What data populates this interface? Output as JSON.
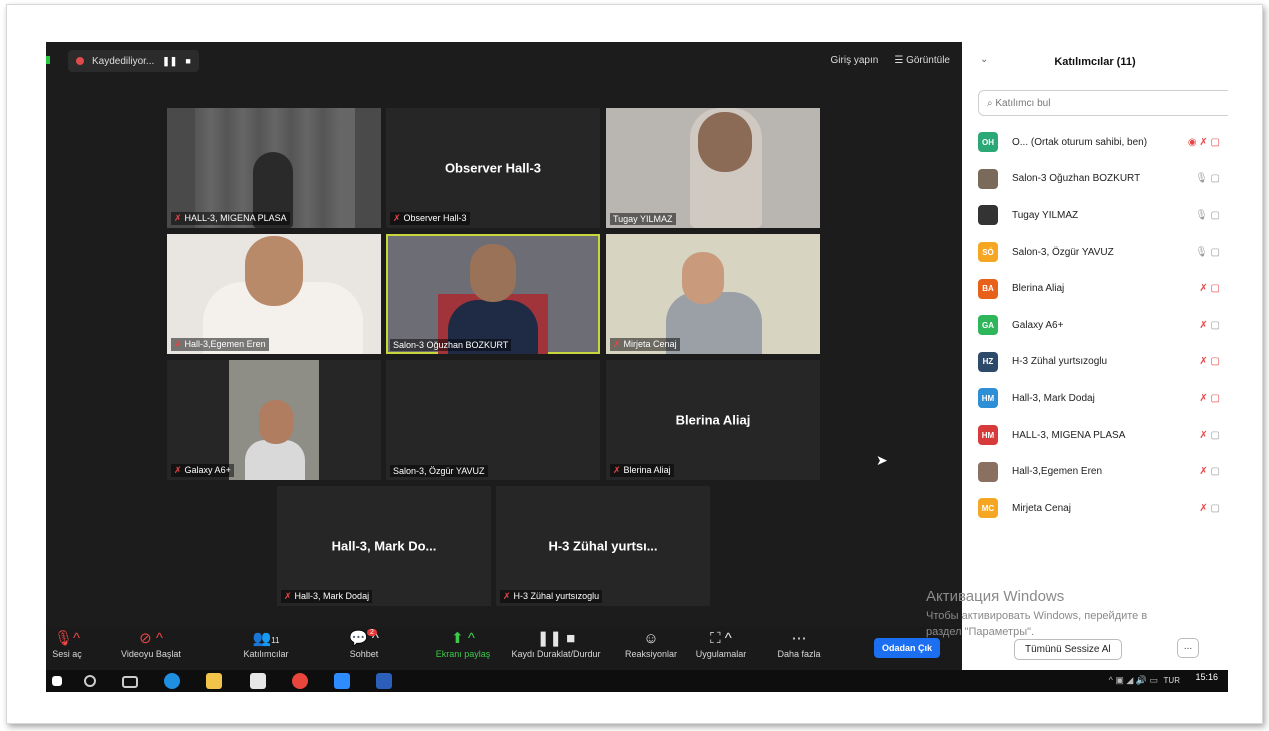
{
  "recording": {
    "label": "Kaydediliyor...",
    "pause_icon": "pause-icon",
    "stop_icon": "stop-icon"
  },
  "topbar": {
    "signin": "Giriş yapın",
    "view": "Görüntüle"
  },
  "tiles": [
    {
      "label": "HALL-3, MIGENA PLASA",
      "muted": true
    },
    {
      "label": "Observer Hall-3",
      "muted": true,
      "center": "Observer Hall-3"
    },
    {
      "label": "Tugay YILMAZ",
      "muted": false
    },
    {
      "label": "Hall-3,Egemen Eren",
      "muted": true
    },
    {
      "label": "Salon-3 Oğuzhan BOZKURT",
      "muted": false
    },
    {
      "label": "Mirjeta Cenaj",
      "muted": true
    },
    {
      "label": "Galaxy A6+",
      "muted": true
    },
    {
      "label": "Salon-3, Özgür YAVUZ",
      "muted": false
    },
    {
      "label": "Blerina Aliaj",
      "muted": true,
      "center": "Blerina Aliaj"
    },
    {
      "label": "Hall-3, Mark Dodaj",
      "muted": true,
      "center": "Hall-3, Mark Do..."
    },
    {
      "label": "H-3 Zühal yurtsızoglu",
      "muted": true,
      "center": "H-3 Zühal yurtsı..."
    }
  ],
  "toolbar": {
    "audio": "Sesi aç",
    "video": "Videoyu Başlat",
    "participants": "Katılımcılar",
    "participants_count": "11",
    "chat": "Sohbet",
    "chat_badge": "2",
    "share": "Ekranı paylaş",
    "record": "Kaydı Duraklat/Durdur",
    "reactions": "Reaksiyonlar",
    "apps": "Uygulamalar",
    "more": "Daha fazla",
    "leave": "Odadan Çık"
  },
  "panel": {
    "title": "Katılımcılar (11)",
    "search_placeholder": "Katılımcı bul",
    "participants": [
      {
        "initials": "OH",
        "name": "O... (Ortak oturum sahibi, ben)",
        "color": "#2aa876"
      },
      {
        "initials": "",
        "name": "Salon-3 Oğuzhan BOZKURT",
        "color": "#7a6a5a"
      },
      {
        "initials": "",
        "name": "Tugay YILMAZ",
        "color": "#333333"
      },
      {
        "initials": "SÖ",
        "name": "Salon-3, Özgür YAVUZ",
        "color": "#f5a623"
      },
      {
        "initials": "BA",
        "name": "Blerina Aliaj",
        "color": "#e8611a"
      },
      {
        "initials": "GA",
        "name": "Galaxy A6+",
        "color": "#2fb55a"
      },
      {
        "initials": "HZ",
        "name": "H-3 Zühal yurtsızoglu",
        "color": "#2e4a6b"
      },
      {
        "initials": "HM",
        "name": "Hall-3, Mark Dodaj",
        "color": "#2e8fd6"
      },
      {
        "initials": "HM",
        "name": "HALL-3, MIGENA PLASA",
        "color": "#d63a3a"
      },
      {
        "initials": "",
        "name": "Hall-3,Egemen Eren",
        "color": "#8a7060"
      },
      {
        "initials": "MC",
        "name": "Mirjeta Cenaj",
        "color": "#f5a623"
      }
    ],
    "mute_all": "Tümünü Sessize Al",
    "more": "..."
  },
  "watermark": {
    "line1": "Активация Windows",
    "line2": "Чтобы активировать Windows, перейдите в",
    "line3": "раздел \"Параметры\"."
  },
  "taskbar": {
    "lang": "TUR",
    "time": "15:16"
  }
}
